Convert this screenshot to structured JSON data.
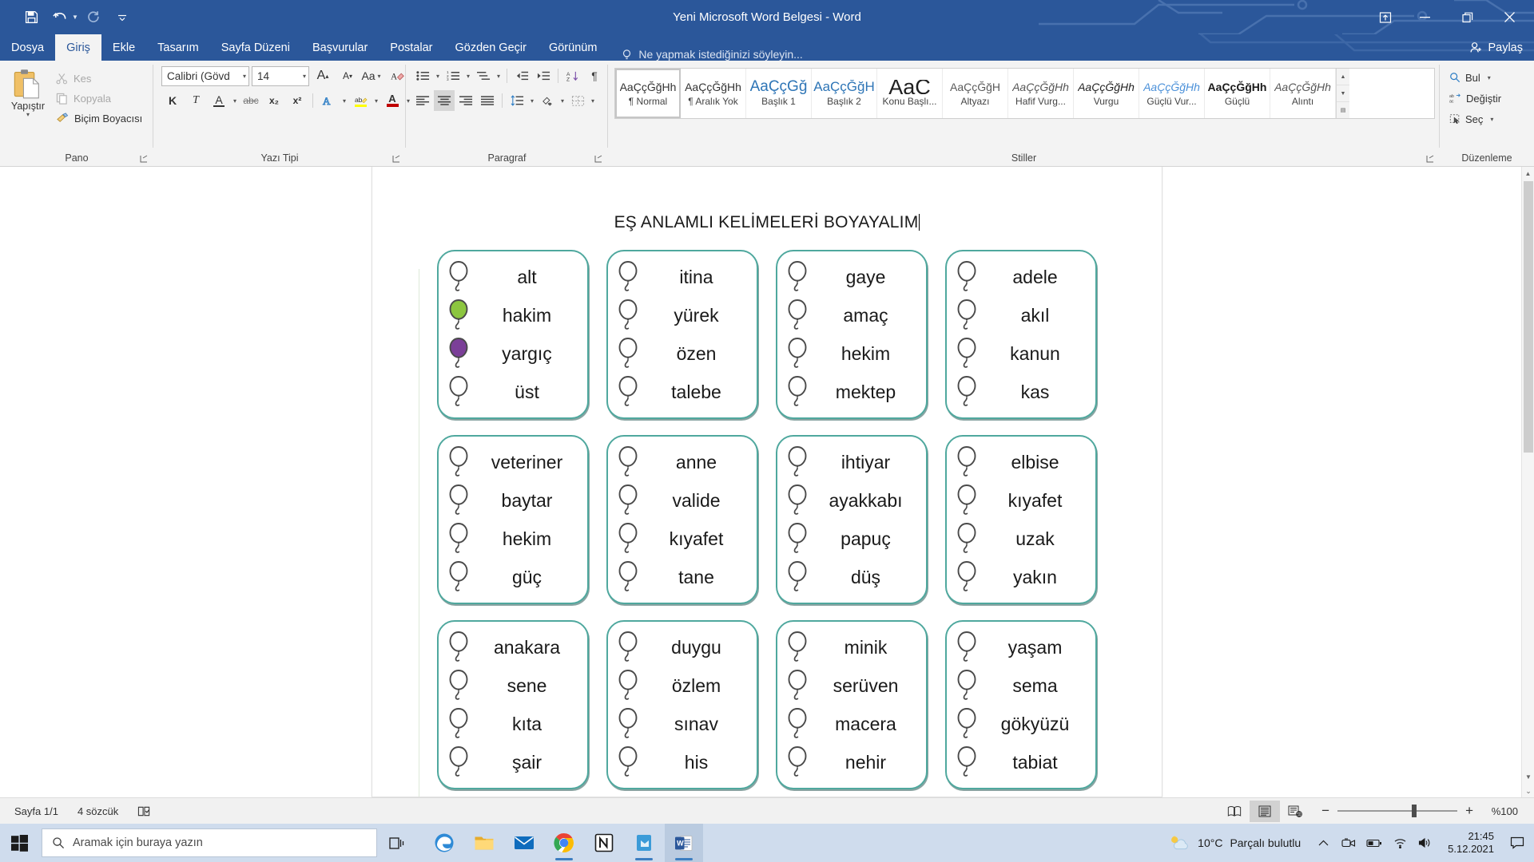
{
  "window": {
    "title": "Yeni Microsoft Word Belgesi - Word",
    "quick_access": [
      {
        "name": "save-icon",
        "label": "Kaydet"
      },
      {
        "name": "undo-icon",
        "label": "Geri Al"
      },
      {
        "name": "redo-icon",
        "label": "Yinele"
      },
      {
        "name": "customize-qat-icon",
        "label": "Hızlı Erişim Araç Çubuğunu Özelleştir"
      }
    ],
    "ribbon_display_label": "Şerit Görüntüleme Seçenekleri",
    "minimize_label": "Simge Durumuna Küçült",
    "restore_label": "Geri Yükle",
    "close_label": "Kapat",
    "accent": "#2b579a"
  },
  "tabs": [
    {
      "label": "Dosya",
      "active": false
    },
    {
      "label": "Giriş",
      "active": true
    },
    {
      "label": "Ekle",
      "active": false
    },
    {
      "label": "Tasarım",
      "active": false
    },
    {
      "label": "Sayfa Düzeni",
      "active": false
    },
    {
      "label": "Başvurular",
      "active": false
    },
    {
      "label": "Postalar",
      "active": false
    },
    {
      "label": "Gözden Geçir",
      "active": false
    },
    {
      "label": "Görünüm",
      "active": false
    }
  ],
  "tell_me": {
    "placeholder": "Ne yapmak istediğinizi söyleyin..."
  },
  "share": {
    "label": "Paylaş"
  },
  "ribbon": {
    "clipboard": {
      "group_label": "Pano",
      "paste_label": "Yapıştır",
      "items": [
        {
          "label": "Kes",
          "icon": "scissors-icon",
          "enabled": false
        },
        {
          "label": "Kopyala",
          "icon": "copy-icon",
          "enabled": false
        },
        {
          "label": "Biçim Boyacısı",
          "icon": "format-painter-icon",
          "enabled": true
        }
      ]
    },
    "font": {
      "group_label": "Yazı Tipi",
      "font_family": "Calibri (Gövd",
      "font_size": "14",
      "grow_label": "Yazı Tipini Büyüt",
      "shrink_label": "Yazı Tipini Küçült",
      "change_case_label": "Aa",
      "clear_format_label": "Tüm Biçimlendirmeyi Temizle",
      "bold_label": "K",
      "italic_label": "T",
      "underline_label": "A",
      "strike_label": "abc",
      "subscript_label": "x₂",
      "superscript_label": "x²",
      "text_effects_label": "A",
      "highlight_label": "ab",
      "font_color_label": "A",
      "highlight_color": "#ffff00",
      "font_color": "#c00000"
    },
    "paragraph": {
      "group_label": "Paragraf",
      "buttons": [
        "bullets-icon",
        "numbering-icon",
        "multilevel-list-icon",
        "decrease-indent-icon",
        "increase-indent-icon",
        "sort-icon",
        "show-marks-icon",
        "align-left-icon",
        "align-center-icon",
        "align-right-icon",
        "justify-icon",
        "line-spacing-icon",
        "shading-icon",
        "borders-icon"
      ]
    },
    "styles": {
      "group_label": "Stiller",
      "items": [
        {
          "preview": "AaÇçĞğHh",
          "name": "¶ Normal",
          "selected": true,
          "style": "normal"
        },
        {
          "preview": "AaÇçĞğHh",
          "name": "¶ Aralık Yok",
          "selected": false,
          "style": "normal"
        },
        {
          "preview": "AaÇçĞğ",
          "name": "Başlık 1",
          "selected": false,
          "style": "heading1"
        },
        {
          "preview": "AaÇçĞğH",
          "name": "Başlık 2",
          "selected": false,
          "style": "heading2"
        },
        {
          "preview": "AaÇ",
          "name": "Konu Başlı...",
          "selected": false,
          "style": "title"
        },
        {
          "preview": "AaÇçĞğH",
          "name": "Altyazı",
          "selected": false,
          "style": "subtitle"
        },
        {
          "preview": "AaÇçĞğHh",
          "name": "Hafif Vurg...",
          "selected": false,
          "style": "subtle-em"
        },
        {
          "preview": "AaÇçĞğHh",
          "name": "Vurgu",
          "selected": false,
          "style": "emphasis"
        },
        {
          "preview": "AaÇçĞğHh",
          "name": "Güçlü Vur...",
          "selected": false,
          "style": "intense-em"
        },
        {
          "preview": "AaÇçĞğHh",
          "name": "Güçlü",
          "selected": false,
          "style": "strong"
        },
        {
          "preview": "AaÇçĞğHh",
          "name": "Alıntı",
          "selected": false,
          "style": "quote"
        }
      ]
    },
    "editing": {
      "group_label": "Düzenleme",
      "items": [
        {
          "label": "Bul",
          "icon": "search-icon",
          "has_caret": true
        },
        {
          "label": "Değiştir",
          "icon": "replace-icon",
          "has_caret": false
        },
        {
          "label": "Seç",
          "icon": "select-icon",
          "has_caret": true
        }
      ]
    }
  },
  "document": {
    "title": "EŞ ANLAMLI KELİMELERİ BOYAYALIM",
    "card_border_color": "#4fa89e",
    "balloon_colors": {
      "green": "#8cc63f",
      "purple": "#7b3f98",
      "outline": "#4a4a4a"
    },
    "cards": [
      {
        "words": [
          {
            "text": "alt",
            "fill": "none"
          },
          {
            "text": "hakim",
            "fill": "green"
          },
          {
            "text": "yargıç",
            "fill": "purple"
          },
          {
            "text": "üst",
            "fill": "none"
          }
        ]
      },
      {
        "words": [
          {
            "text": "itina",
            "fill": "none"
          },
          {
            "text": "yürek",
            "fill": "none"
          },
          {
            "text": "özen",
            "fill": "none"
          },
          {
            "text": "talebe",
            "fill": "none"
          }
        ]
      },
      {
        "words": [
          {
            "text": "gaye",
            "fill": "none"
          },
          {
            "text": "amaç",
            "fill": "none"
          },
          {
            "text": "hekim",
            "fill": "none"
          },
          {
            "text": "mektep",
            "fill": "none"
          }
        ]
      },
      {
        "words": [
          {
            "text": "adele",
            "fill": "none"
          },
          {
            "text": "akıl",
            "fill": "none"
          },
          {
            "text": "kanun",
            "fill": "none"
          },
          {
            "text": "kas",
            "fill": "none"
          }
        ]
      },
      {
        "words": [
          {
            "text": "veteriner",
            "fill": "none"
          },
          {
            "text": "baytar",
            "fill": "none"
          },
          {
            "text": "hekim",
            "fill": "none"
          },
          {
            "text": "güç",
            "fill": "none"
          }
        ]
      },
      {
        "words": [
          {
            "text": "anne",
            "fill": "none"
          },
          {
            "text": "valide",
            "fill": "none"
          },
          {
            "text": "kıyafet",
            "fill": "none"
          },
          {
            "text": "tane",
            "fill": "none"
          }
        ]
      },
      {
        "words": [
          {
            "text": "ihtiyar",
            "fill": "none"
          },
          {
            "text": "ayakkabı",
            "fill": "none"
          },
          {
            "text": "papuç",
            "fill": "none"
          },
          {
            "text": "düş",
            "fill": "none"
          }
        ]
      },
      {
        "words": [
          {
            "text": "elbise",
            "fill": "none"
          },
          {
            "text": "kıyafet",
            "fill": "none"
          },
          {
            "text": "uzak",
            "fill": "none"
          },
          {
            "text": "yakın",
            "fill": "none"
          }
        ]
      },
      {
        "words": [
          {
            "text": "anakara",
            "fill": "none"
          },
          {
            "text": "sene",
            "fill": "none"
          },
          {
            "text": "kıta",
            "fill": "none"
          },
          {
            "text": "şair",
            "fill": "none"
          }
        ]
      },
      {
        "words": [
          {
            "text": "duygu",
            "fill": "none"
          },
          {
            "text": "özlem",
            "fill": "none"
          },
          {
            "text": "sınav",
            "fill": "none"
          },
          {
            "text": "his",
            "fill": "none"
          }
        ]
      },
      {
        "words": [
          {
            "text": "minik",
            "fill": "none"
          },
          {
            "text": "serüven",
            "fill": "none"
          },
          {
            "text": "macera",
            "fill": "none"
          },
          {
            "text": "nehir",
            "fill": "none"
          }
        ]
      },
      {
        "words": [
          {
            "text": "yaşam",
            "fill": "none"
          },
          {
            "text": "sema",
            "fill": "none"
          },
          {
            "text": "gökyüzü",
            "fill": "none"
          },
          {
            "text": "tabiat",
            "fill": "none"
          }
        ]
      }
    ]
  },
  "status_bar": {
    "page": "Sayfa 1/1",
    "words": "4 sözcük",
    "proofing_icon": "proofing-icon",
    "views": [
      {
        "name": "read-mode-icon",
        "active": false
      },
      {
        "name": "print-layout-icon",
        "active": true
      },
      {
        "name": "web-layout-icon",
        "active": false
      }
    ],
    "zoom_out_label": "−",
    "zoom_in_label": "+",
    "zoom_level": "%100"
  },
  "taskbar": {
    "search_placeholder": "Aramak için buraya yazın",
    "start_label": "Başlat",
    "task_view_label": "Görev Görünümü",
    "apps": [
      {
        "name": "edge-icon",
        "running": false,
        "active": false
      },
      {
        "name": "file-explorer-icon",
        "running": false,
        "active": false
      },
      {
        "name": "mail-icon",
        "running": false,
        "active": false
      },
      {
        "name": "chrome-icon",
        "running": true,
        "active": false
      },
      {
        "name": "notion-icon",
        "running": false,
        "active": false
      },
      {
        "name": "store-icon",
        "running": true,
        "active": false
      },
      {
        "name": "word-icon",
        "running": true,
        "active": true
      }
    ],
    "weather": {
      "temp": "10°C",
      "desc": "Parçalı bulutlu",
      "icon": "partly-cloudy-night-icon"
    },
    "tray": [
      {
        "name": "show-hidden-icons-icon"
      },
      {
        "name": "camera-icon"
      },
      {
        "name": "battery-icon"
      },
      {
        "name": "wifi-icon"
      },
      {
        "name": "volume-icon"
      }
    ],
    "clock": {
      "time": "21:45",
      "date": "5.12.2021"
    },
    "notification_label": "Bildirim Merkezi"
  }
}
